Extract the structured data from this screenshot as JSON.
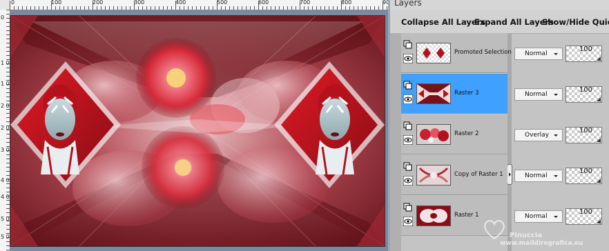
{
  "panel": {
    "title": "Layers",
    "toolbar": {
      "collapse_label": "Collapse All Layers",
      "expand_label": "Expand All Layers",
      "showhide_label": "Show/Hide Quick S"
    }
  },
  "rulers": {
    "top_labels": [
      "0",
      "100",
      "200",
      "300",
      "400",
      "500",
      "600",
      "700",
      "800",
      "900"
    ],
    "left_labels": [
      "0",
      "1 0",
      "1 0",
      "2 0",
      "2 0",
      "3 0",
      "4 0",
      "4 0",
      "5 0",
      "5 0"
    ]
  },
  "layers": [
    {
      "name": "Promoted Selection",
      "blend": "Normal",
      "opacity": "100",
      "selected": false
    },
    {
      "name": "Raster 3",
      "blend": "Normal",
      "opacity": "100",
      "selected": true
    },
    {
      "name": "Raster 2",
      "blend": "Overlay",
      "opacity": "100",
      "selected": false
    },
    {
      "name": "Copy of Raster 1",
      "blend": "Normal",
      "opacity": "100",
      "selected": false
    },
    {
      "name": "Raster 1",
      "blend": "Normal",
      "opacity": "100",
      "selected": false
    }
  ],
  "watermark": {
    "name": "Pinuccia",
    "url": "www.maildiregrafica.eu"
  },
  "colors": {
    "selected_row": "#3fa0ff",
    "canvas_bg": "#7a8aa3",
    "art_red": "#c0101c"
  }
}
